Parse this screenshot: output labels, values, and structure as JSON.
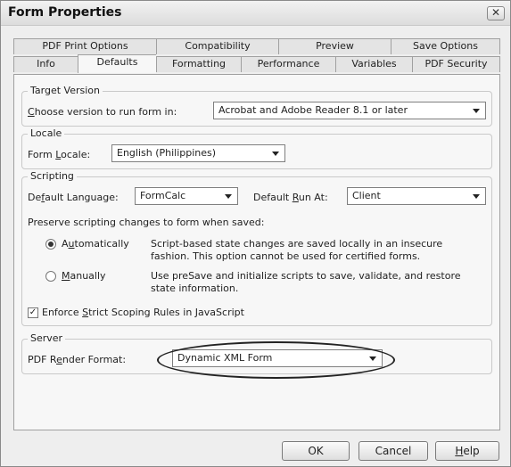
{
  "window": {
    "title": "Form Properties",
    "close_glyph": "✕"
  },
  "tabs_row1": [
    {
      "label": "PDF Print Options"
    },
    {
      "label": "Compatibility"
    },
    {
      "label": "Preview"
    },
    {
      "label": "Save Options"
    }
  ],
  "tabs_row2": [
    {
      "label": "Info"
    },
    {
      "label": "Defaults",
      "active": true
    },
    {
      "label": "Formatting"
    },
    {
      "label": "Performance"
    },
    {
      "label": "Variables"
    },
    {
      "label": "PDF Security"
    }
  ],
  "target_version": {
    "legend": "Target Version",
    "label_u": "C",
    "label_rest": "hoose version to run form in:",
    "value": "Acrobat and Adobe Reader 8.1 or later"
  },
  "locale": {
    "legend": "Locale",
    "label_pre": "Form ",
    "label_u": "L",
    "label_rest": "ocale:",
    "value": "English (Philippines)"
  },
  "scripting": {
    "legend": "Scripting",
    "lang_pre": "De",
    "lang_u": "f",
    "lang_rest": "ault Language:",
    "lang_value": "FormCalc",
    "run_pre": "Default ",
    "run_u": "R",
    "run_rest": "un At:",
    "run_value": "Client",
    "preserve_label": "Preserve scripting changes to form when saved:",
    "auto_pre": "A",
    "auto_u": "u",
    "auto_rest": "tomatically",
    "auto_desc_1": "Script-based state changes are saved locally in an insecure",
    "auto_desc_2": "fashion. This option cannot be used for certified forms.",
    "manual_u": "M",
    "manual_rest": "anually",
    "manual_desc_1": "Use preSave and initialize scripts to save, validate, and restore",
    "manual_desc_2": "state information.",
    "strict_pre": "Enforce ",
    "strict_u": "S",
    "strict_rest": "trict Scoping Rules in JavaScript"
  },
  "server": {
    "legend": "Server",
    "label_pre": "PDF R",
    "label_u": "e",
    "label_rest": "nder Format:",
    "value": "Dynamic XML Form"
  },
  "buttons": {
    "ok": "OK",
    "cancel": "Cancel",
    "help_u": "H",
    "help_rest": "elp"
  }
}
